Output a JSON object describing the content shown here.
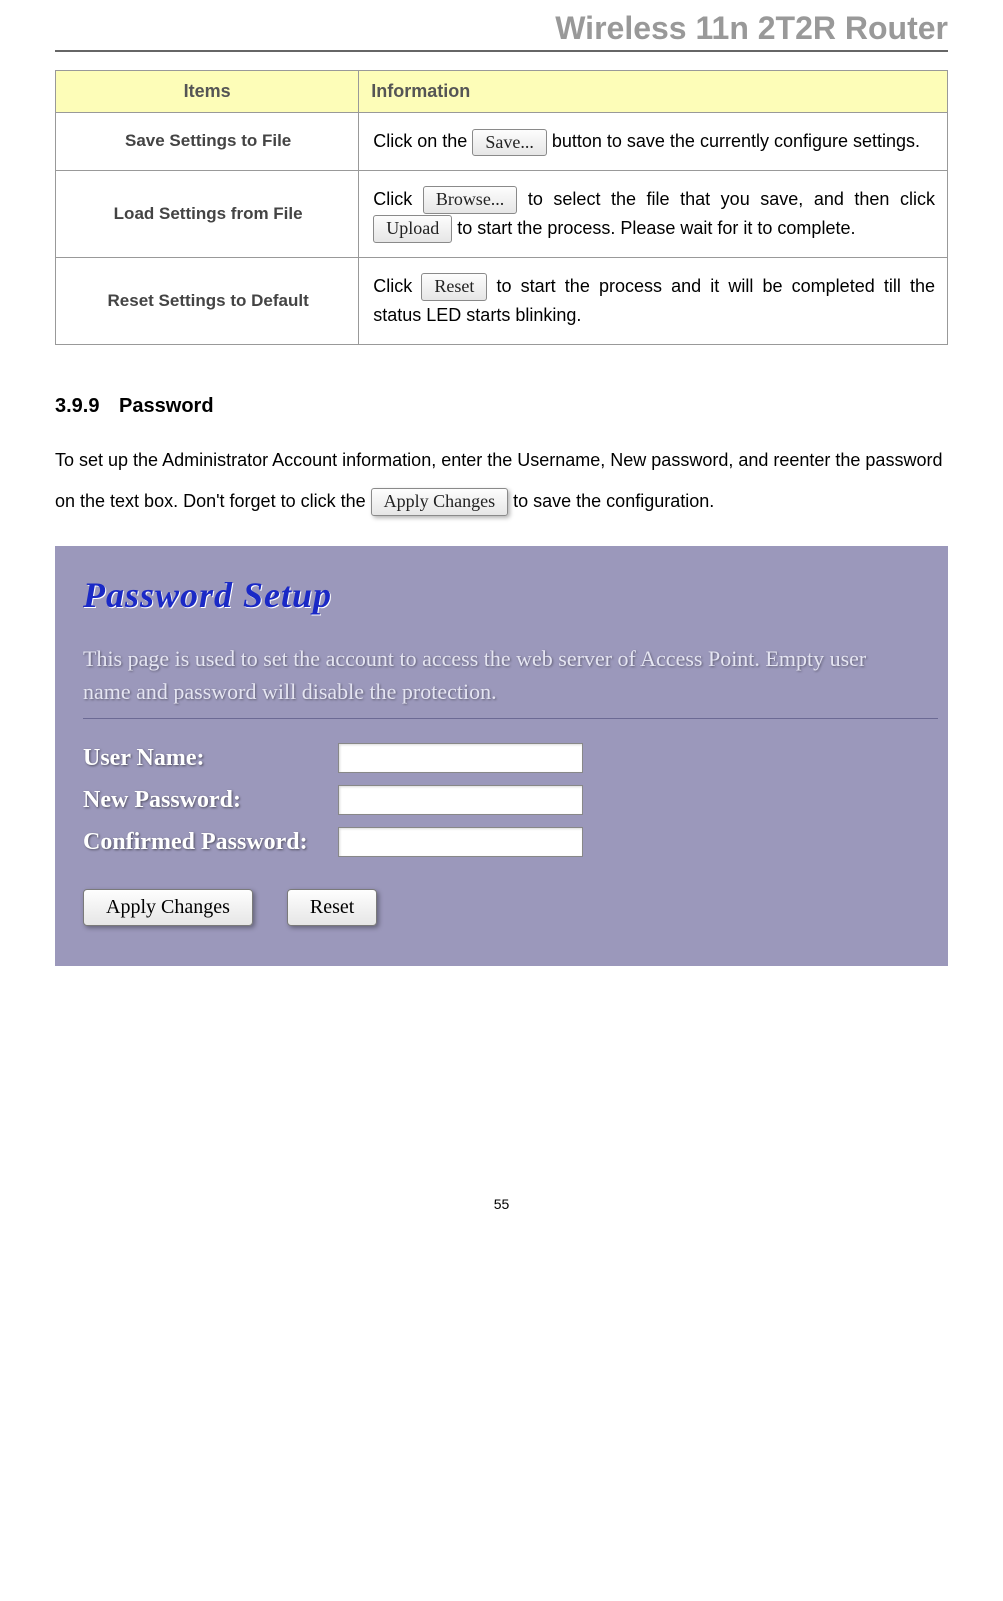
{
  "header": {
    "title": "Wireless 11n 2T2R Router"
  },
  "table": {
    "headers": {
      "col1": "Items",
      "col2": "Information"
    },
    "rows": [
      {
        "item": "Save Settings to File",
        "info_before": "Click on the",
        "btn1": "Save...",
        "info_mid": " button to save the currently configure settings."
      },
      {
        "item": "Load Settings from File",
        "info_before": "Click ",
        "btn1": "Browse...",
        "info_mid": " to select the file that you save, and then click ",
        "btn2": "Upload",
        "info_after": " to start the process. Please wait for it to complete."
      },
      {
        "item": "Reset Settings to Default",
        "info_before": "Click ",
        "btn1": "Reset",
        "info_mid": " to start the process and it will be completed till the status LED starts blinking."
      }
    ]
  },
  "section": {
    "number": "3.9.9",
    "title": "Password",
    "desc_before": "To set up the Administrator Account information, enter the Username, New password, and reenter the password on the text box. Don't forget to click the ",
    "desc_btn": "Apply Changes",
    "desc_after": " to save the configuration."
  },
  "panel": {
    "title": "Password Setup",
    "desc": "This page is used to set the account to access the web server of Access Point. Empty user name and password will disable the protection.",
    "labels": {
      "username": "User Name:",
      "newpw": "New Password:",
      "confirmpw": "Confirmed Password:"
    },
    "buttons": {
      "apply": "Apply Changes",
      "reset": "Reset"
    }
  },
  "pageNumber": "55"
}
